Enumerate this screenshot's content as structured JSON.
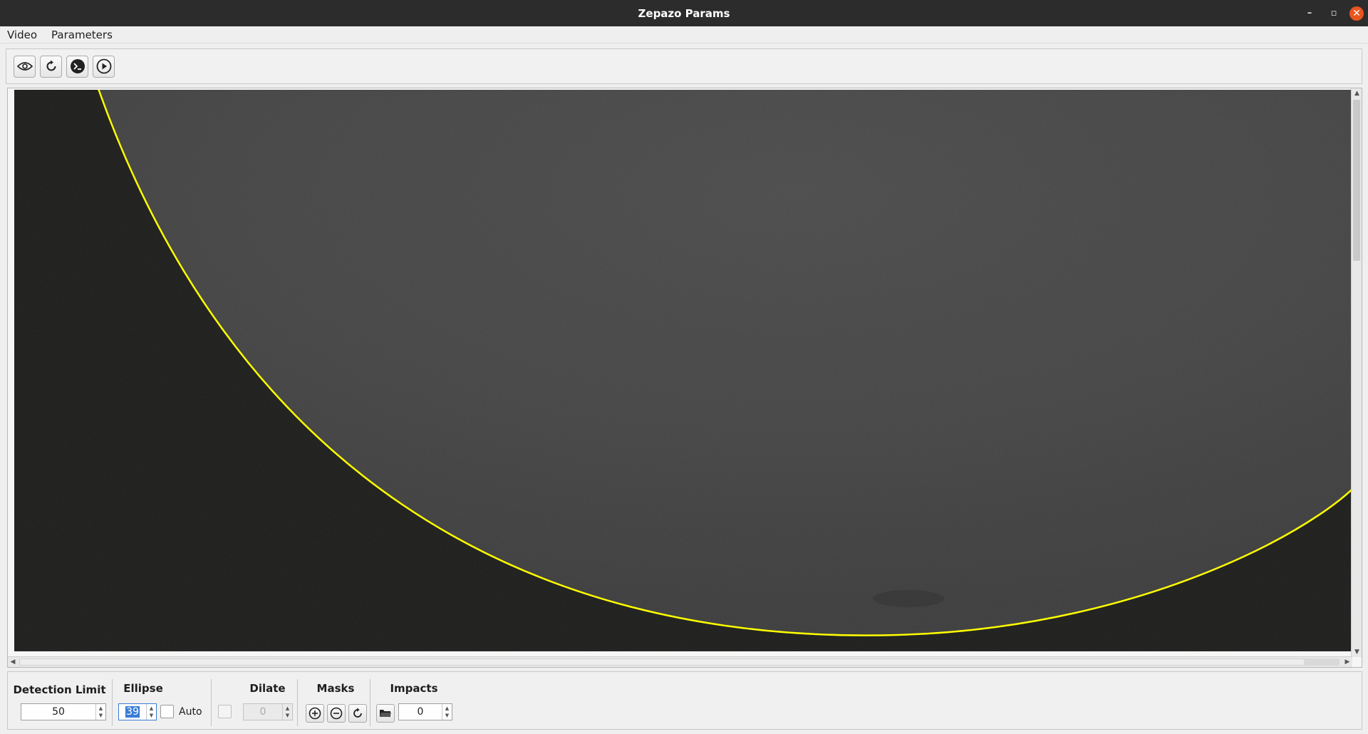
{
  "window": {
    "title": "Zepazo Params",
    "minimize_icon": "–",
    "maximize_icon": "▫",
    "close_icon": "✕"
  },
  "menu": [
    "Video",
    "Parameters"
  ],
  "toolbar": {
    "buttons": [
      "eye-icon",
      "rotate-icon",
      "terminal-icon",
      "play-icon"
    ]
  },
  "viewport": {
    "overlay_color": "#ffff00",
    "scroll_up": "▲",
    "scroll_down": "▼",
    "scroll_left": "◀",
    "scroll_right": "▶"
  },
  "panel": {
    "detection_limit": {
      "title": "Detection Limit",
      "value": "50"
    },
    "ellipse": {
      "title": "Ellipse",
      "value": "39",
      "auto_label": "Auto",
      "auto_checked": false
    },
    "dilate": {
      "title": "Dilate",
      "value": "0",
      "enabled": false
    },
    "masks": {
      "title": "Masks",
      "buttons": [
        "add-mask-icon",
        "remove-mask-icon",
        "reset-mask-icon"
      ]
    },
    "impacts": {
      "title": "Impacts",
      "value": "0"
    },
    "spin_up": "▲",
    "spin_down": "▼"
  }
}
